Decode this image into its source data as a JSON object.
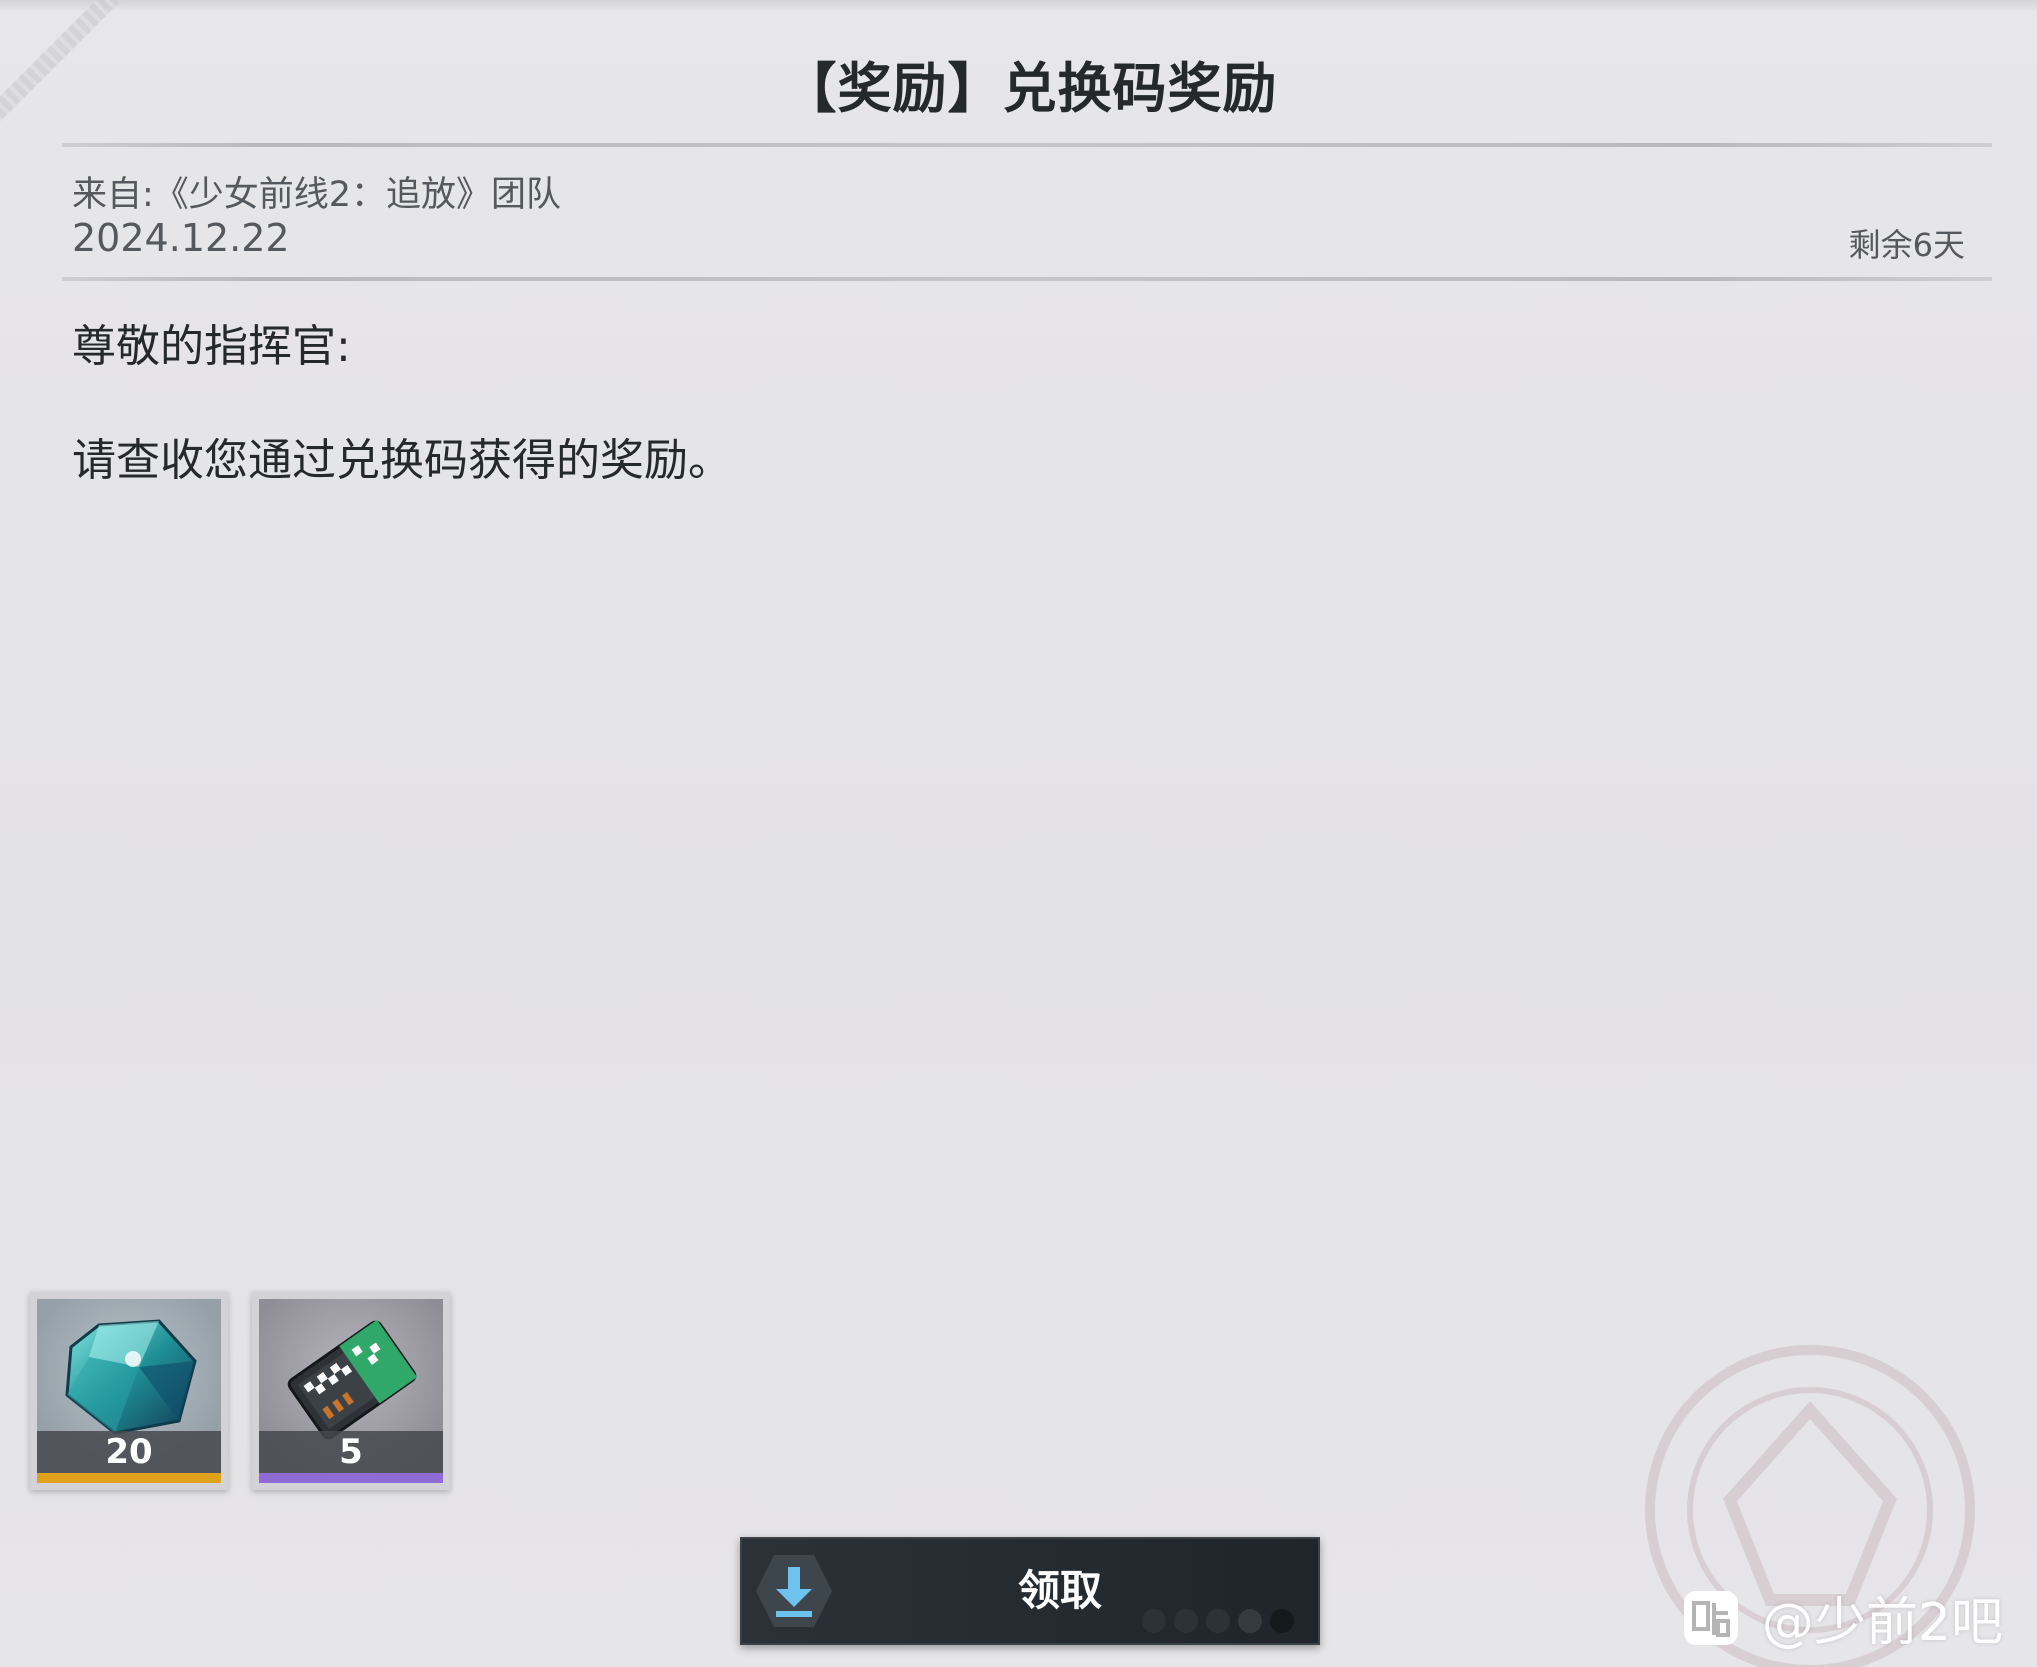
{
  "mail": {
    "title": "【奖励】兑换码奖励",
    "sender": "来自:《少女前线2：追放》团队",
    "date": "2024.12.22",
    "remaining": "剩余6天",
    "greeting": "尊敬的指挥官:",
    "body": "请查收您通过兑换码获得的奖励。"
  },
  "rewards": [
    {
      "icon": "crystal-gem-icon",
      "quantity": "20",
      "rarity_color": "#e1a21b"
    },
    {
      "icon": "data-chip-icon",
      "quantity": "5",
      "rarity_color": "#8f6bd6"
    }
  ],
  "claim_button": {
    "label": "领取",
    "icon": "download-icon",
    "icon_color": "#6ec3ee"
  },
  "watermark": {
    "icon": "tieba-icon",
    "text": "@少前2吧"
  }
}
